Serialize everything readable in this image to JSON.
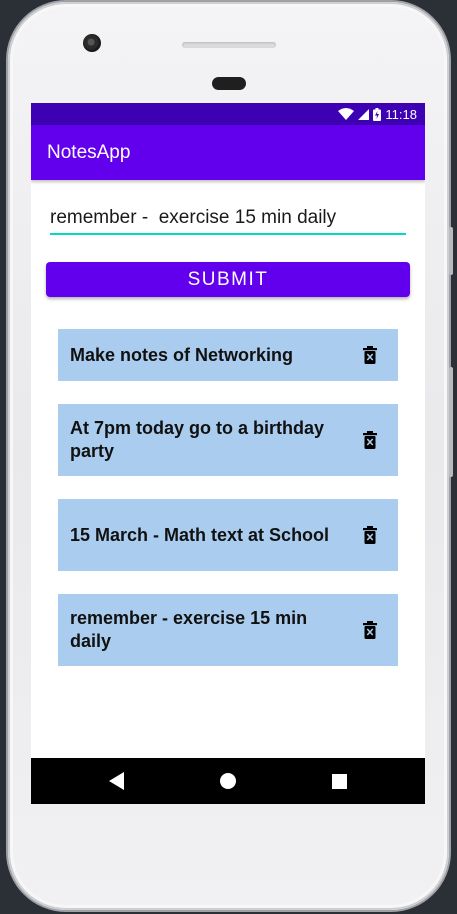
{
  "status_bar": {
    "time": "11:18"
  },
  "app_bar": {
    "title": "NotesApp"
  },
  "input": {
    "value": "remember -  exercise 15 min daily"
  },
  "submit": {
    "label": "SUBMIT"
  },
  "notes": [
    {
      "text": "Make notes of Networking"
    },
    {
      "text": "At 7pm today go to a birthday party"
    },
    {
      "text": "15 March - Math text at School"
    },
    {
      "text": "remember -  exercise 15 min daily"
    }
  ],
  "colors": {
    "primary": "#6200ee",
    "status_bar": "#3d00b3",
    "accent": "#03dac5",
    "note_background": "#aacdef"
  },
  "icons": {
    "delete": "delete-icon",
    "back": "back-icon",
    "home": "home-icon",
    "recents": "recents-icon",
    "wifi": "wifi-icon",
    "signal": "signal-icon",
    "battery": "battery-icon"
  }
}
